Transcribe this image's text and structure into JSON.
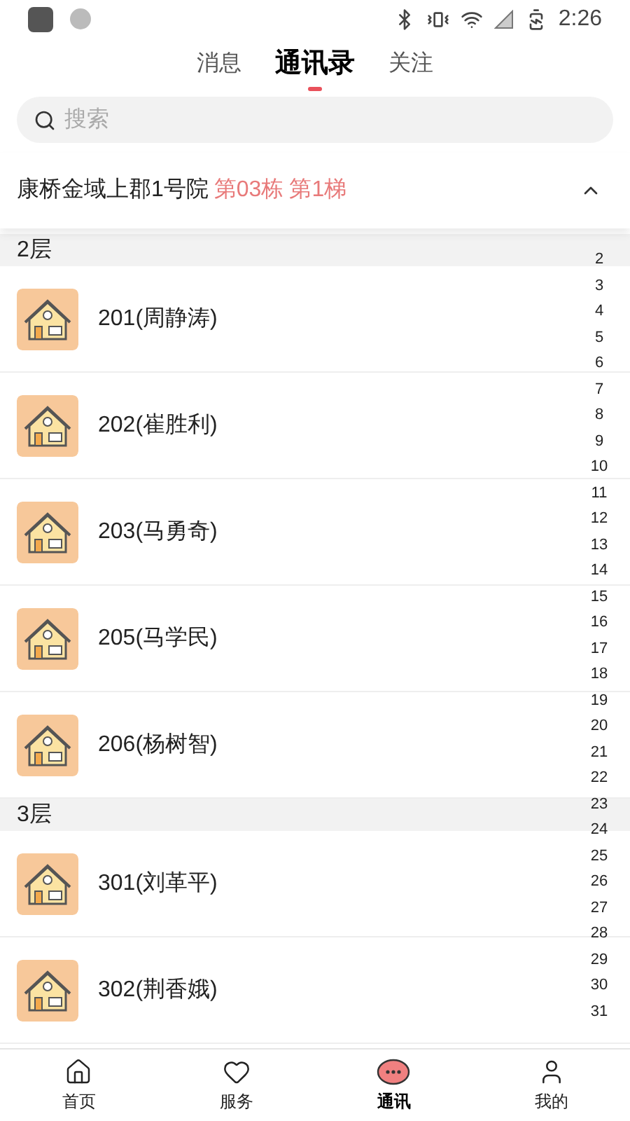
{
  "status_bar": {
    "time": "2:26"
  },
  "tabs": [
    {
      "label": "消息",
      "selected": false
    },
    {
      "label": "通讯录",
      "selected": true
    },
    {
      "label": "关注",
      "selected": false
    }
  ],
  "search": {
    "placeholder": "搜索"
  },
  "location": {
    "name": "康桥金域上郡1号院",
    "building": "第03栋",
    "unit": "第1梯",
    "expanded": true
  },
  "floors": [
    {
      "title": "2层",
      "rooms": [
        "201(周静涛)",
        "202(崔胜利)",
        "203(马勇奇)",
        "205(马学民)",
        "206(杨树智)"
      ]
    },
    {
      "title": "3层",
      "rooms": [
        "301(刘革平)",
        "302(荆香娥)"
      ]
    }
  ],
  "index": [
    "2",
    "3",
    "4",
    "5",
    "6",
    "7",
    "8",
    "9",
    "10",
    "11",
    "12",
    "13",
    "14",
    "15",
    "16",
    "17",
    "18",
    "19",
    "20",
    "21",
    "22",
    "23",
    "24",
    "25",
    "26",
    "27",
    "28",
    "29",
    "30",
    "31"
  ],
  "nav": [
    {
      "label": "首页",
      "kind": "home",
      "selected": false
    },
    {
      "label": "服务",
      "kind": "heart",
      "selected": false
    },
    {
      "label": "通讯",
      "kind": "chat",
      "selected": true
    },
    {
      "label": "我的",
      "kind": "user",
      "selected": false
    }
  ]
}
